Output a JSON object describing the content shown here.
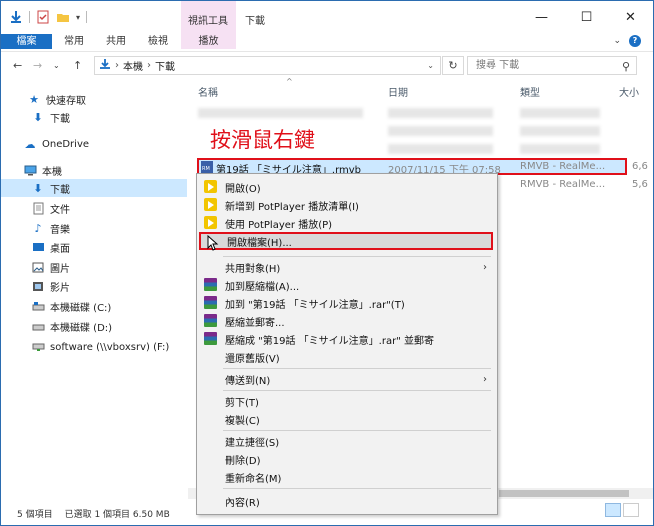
{
  "window": {
    "context_tab_group": "視訊工具",
    "title": "下載",
    "controls": [
      "—",
      "☐",
      "✕"
    ]
  },
  "ribbon": {
    "tabs": [
      "檔案",
      "常用",
      "共用",
      "檢視",
      "播放"
    ]
  },
  "address": {
    "path": [
      "本機",
      "下載"
    ],
    "search_placeholder": "搜尋 下載"
  },
  "sidebar": {
    "items": [
      {
        "label": "快速存取",
        "icon": "star-icon"
      },
      {
        "label": "下載",
        "icon": "download-icon"
      },
      {
        "label": "OneDrive",
        "icon": "cloud-icon"
      },
      {
        "label": "本機",
        "icon": "computer-icon"
      },
      {
        "label": "下載",
        "icon": "download-icon",
        "selected": true
      },
      {
        "label": "文件",
        "icon": "document-icon"
      },
      {
        "label": "音樂",
        "icon": "music-icon"
      },
      {
        "label": "桌面",
        "icon": "desktop-icon"
      },
      {
        "label": "圖片",
        "icon": "picture-icon"
      },
      {
        "label": "影片",
        "icon": "video-icon"
      },
      {
        "label": "本機磁碟 (C:)",
        "icon": "drive-icon"
      },
      {
        "label": "本機磁碟 (D:)",
        "icon": "drive-icon"
      },
      {
        "label": "software (\\\\vboxsrv) (F:)",
        "icon": "network-drive-icon"
      }
    ]
  },
  "filelist": {
    "columns": [
      "名稱",
      "日期",
      "類型",
      "大小"
    ],
    "annotation": "按滑鼠右鍵",
    "selected_file": {
      "name": "第19話 「ミサイル注意」.rmvb",
      "date": "2007/11/15 下午 07:58",
      "type": "RMVB - RealMe...",
      "size": "6,6"
    },
    "next_row": {
      "type": "RMVB - RealMe...",
      "size": "5,6"
    }
  },
  "status": {
    "count": "5 個項目",
    "selection": "已選取 1 個項目  6.50 MB"
  },
  "context_menu": {
    "items": [
      {
        "label": "開啟(O)",
        "icon": "potplayer-icon"
      },
      {
        "label": "新增到 PotPlayer 播放清單(I)",
        "icon": "potplayer-icon"
      },
      {
        "label": "使用 PotPlayer 播放(P)",
        "icon": "potplayer-icon"
      },
      {
        "label": "開啟檔案(H)...",
        "highlight": true
      },
      {
        "label": "共用對象(H)",
        "submenu": true
      },
      {
        "label": "加到壓縮檔(A)...",
        "icon": "winrar-icon"
      },
      {
        "label": "加到 \"第19話 「ミサイル注意」.rar\"(T)",
        "icon": "winrar-icon"
      },
      {
        "label": "壓縮並郵寄...",
        "icon": "winrar-icon"
      },
      {
        "label": "壓縮成 \"第19話 「ミサイル注意」.rar\" 並郵寄",
        "icon": "winrar-icon"
      },
      {
        "label": "還原舊版(V)"
      },
      {
        "label": "傳送到(N)",
        "submenu": true
      },
      {
        "label": "剪下(T)"
      },
      {
        "label": "複製(C)"
      },
      {
        "label": "建立捷徑(S)"
      },
      {
        "label": "刪除(D)"
      },
      {
        "label": "重新命名(M)"
      },
      {
        "label": "內容(R)"
      }
    ]
  },
  "colors": {
    "accent": "#1a6fc4",
    "annotation": "#e0101a",
    "selection": "#cce8ff"
  }
}
